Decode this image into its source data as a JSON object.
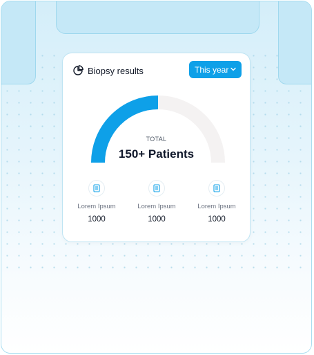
{
  "card": {
    "title": "Biopsy results",
    "period_dropdown": "This year"
  },
  "gauge": {
    "total_label": "TOTAL",
    "total_value": "150+ Patients",
    "filled_fraction": 0.5,
    "colors": {
      "filled": "#0ea0e8",
      "track": "#f4f2f2"
    }
  },
  "stats": [
    {
      "label": "Lorem Ipsum",
      "value": "1000",
      "icon": "document-icon"
    },
    {
      "label": "Lorem Ipsum",
      "value": "1000",
      "icon": "document-icon"
    },
    {
      "label": "Lorem Ipsum",
      "value": "1000",
      "icon": "document-icon"
    }
  ],
  "colors": {
    "accent": "#0ea0e8",
    "frame_border": "#a8ddf0",
    "tab_fill": "#c5e8f7"
  }
}
